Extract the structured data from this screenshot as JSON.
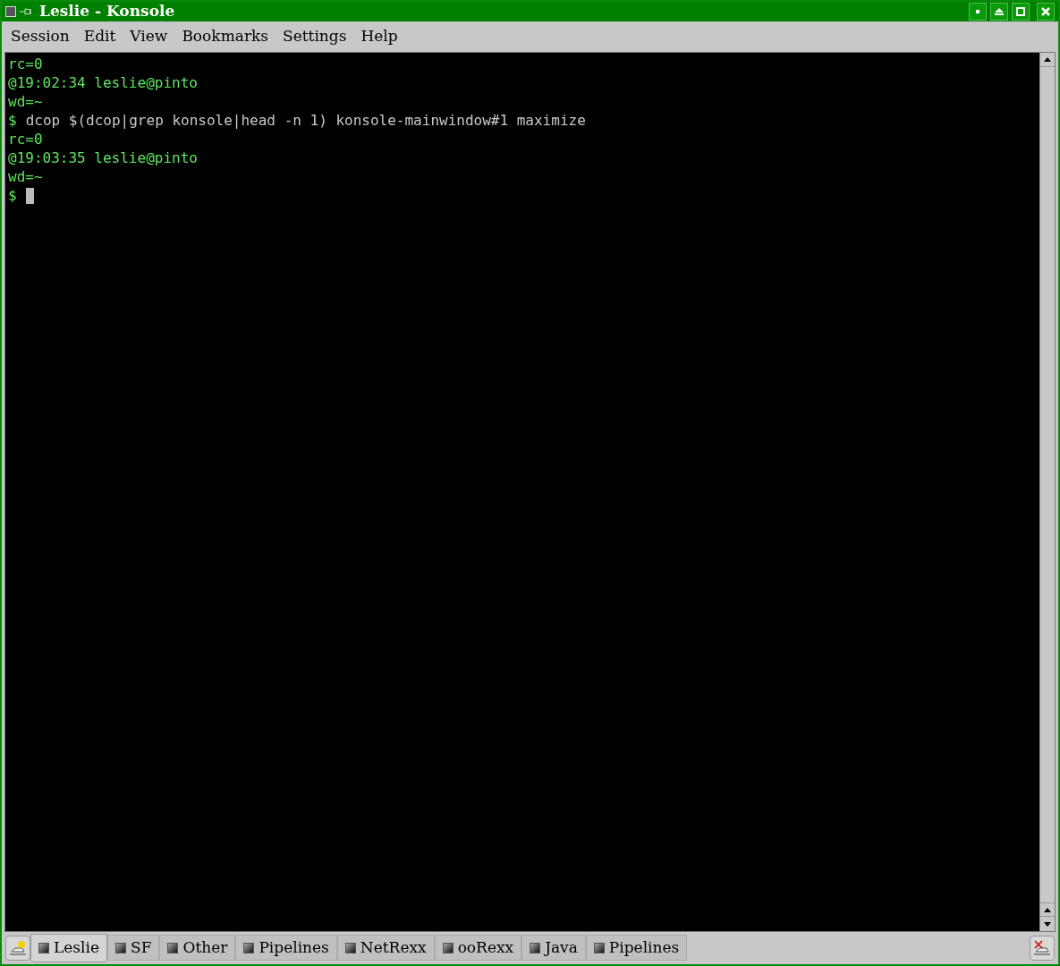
{
  "window": {
    "title": "Leslie - Konsole"
  },
  "menu": [
    "Session",
    "Edit",
    "View",
    "Bookmarks",
    "Settings",
    "Help"
  ],
  "terminal": {
    "lines": [
      {
        "kind": "output",
        "text": "rc=0"
      },
      {
        "kind": "output",
        "text": "@19:02:34 leslie@pinto"
      },
      {
        "kind": "output",
        "text": "wd=~"
      },
      {
        "kind": "command",
        "prompt": "$",
        "text": "dcop $(dcop|grep konsole|head -n 1) konsole-mainwindow#1 maximize"
      },
      {
        "kind": "output",
        "text": "rc=0"
      },
      {
        "kind": "output",
        "text": "@19:03:35 leslie@pinto"
      },
      {
        "kind": "output",
        "text": "wd=~"
      },
      {
        "kind": "cursor",
        "prompt": "$"
      }
    ]
  },
  "tabs": [
    {
      "label": "Leslie",
      "selected": true
    },
    {
      "label": "SF",
      "selected": false
    },
    {
      "label": "Other",
      "selected": false
    },
    {
      "label": "Pipelines",
      "selected": false
    },
    {
      "label": "NetRexx",
      "selected": false
    },
    {
      "label": "ooRexx",
      "selected": false
    },
    {
      "label": "Java",
      "selected": false
    },
    {
      "label": "Pipelines",
      "selected": false
    }
  ]
}
